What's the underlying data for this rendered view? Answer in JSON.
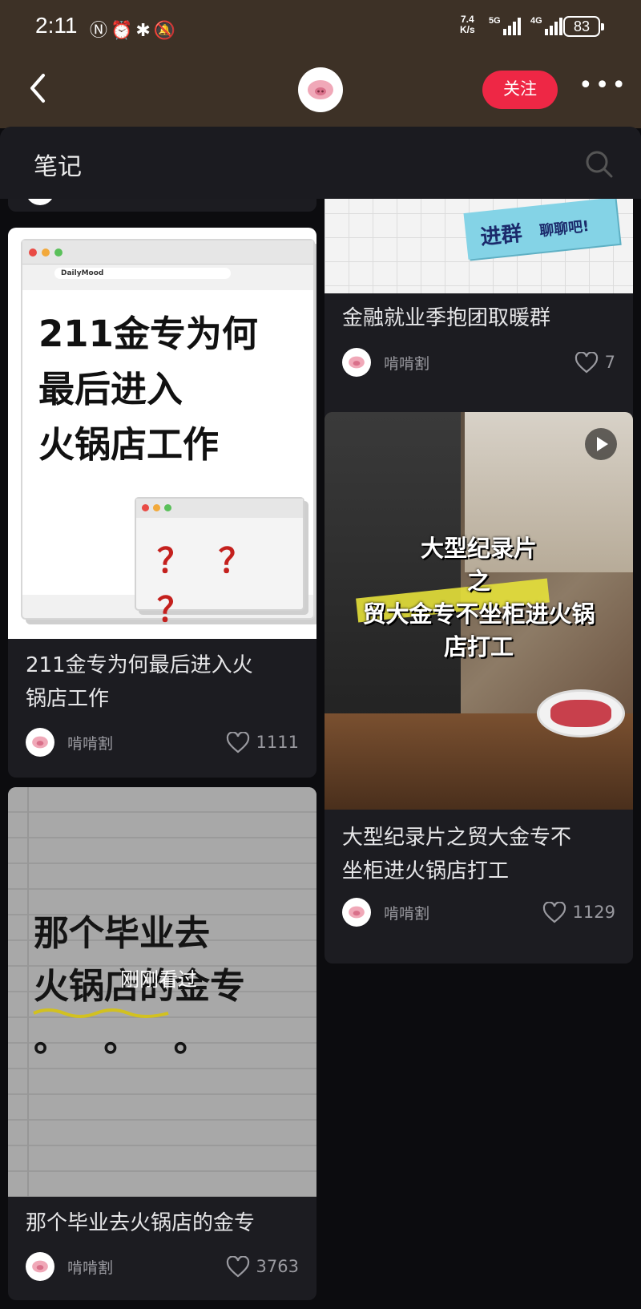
{
  "status": {
    "time": "2:11",
    "speed_top": "7.4",
    "speed_bottom": "K/s",
    "sig1": "5G",
    "sig2": "4G",
    "battery": "83"
  },
  "header": {
    "follow_label": "关注"
  },
  "sheet": {
    "title": "笔记"
  },
  "colors": {
    "accent": "#ee2745",
    "header_bg": "#3d3126",
    "card_bg": "#1c1c21"
  },
  "cards": [
    {
      "title_lines": [
        "211金专为何最后进入火",
        "锅店工作"
      ],
      "cover_lines": [
        "211金专为何",
        "最后进入",
        "火锅店工作"
      ],
      "cover_url": "DailyMood",
      "cover_marks": "？ ？ ？",
      "author": "啃啃割",
      "likes": "1111"
    },
    {
      "title_lines": [
        "那个毕业去火锅店的金专"
      ],
      "cover_lines": [
        "那个毕业去",
        "火锅店的金专",
        "。 。 。"
      ],
      "overlay": "刚刚看过",
      "author": "啃啃割",
      "likes": "3763"
    },
    {
      "title_lines": [
        "金融就业季抱团取暖群"
      ],
      "cover_sticker_a": "进群",
      "cover_sticker_b": "聊聊吧!",
      "author": "啃啃割",
      "likes": "7"
    },
    {
      "title_lines": [
        "大型纪录片之贸大金专不",
        "坐柜进火锅店打工"
      ],
      "cover_lines": [
        "大型纪录片",
        "之",
        "贸大金专不坐柜进火锅",
        "店打工"
      ],
      "author": "啃啃割",
      "likes": "1129"
    }
  ]
}
